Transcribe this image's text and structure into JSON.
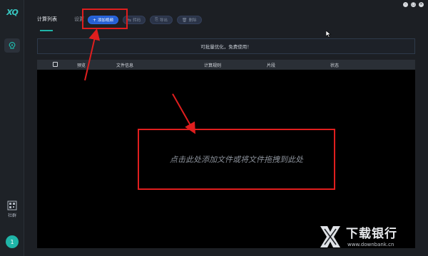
{
  "app": {
    "logo_text": "XQ"
  },
  "window": {
    "controls": [
      "minimize",
      "maximize",
      "close"
    ]
  },
  "tabs": [
    {
      "label": "计算列表",
      "active": true
    },
    {
      "label": "设置",
      "active": false
    }
  ],
  "toolbar": {
    "add_label": "添加视频",
    "transcode_label": "转码",
    "export_label": "导出",
    "delete_label": "删除"
  },
  "notice": {
    "text": "可批量优化，免费使用！"
  },
  "table": {
    "columns": [
      "预览",
      "文件信息",
      "计算规则",
      "片段",
      "状态"
    ],
    "rows": []
  },
  "dropzone": {
    "text": "点击此处添加文件或将文件拖拽到此处"
  },
  "sidebar": {
    "community_label": "社群",
    "user_badge": "1"
  },
  "watermark": {
    "title": "下载银行",
    "url": "www.downbank.cn"
  },
  "colors": {
    "accent": "#1fb5a8",
    "primary_button": "#2560d4",
    "annotation_red": "#e01e1e",
    "background": "#1c1f24",
    "table_bg": "#000000"
  },
  "icons": {
    "brain": "brain-icon",
    "community": "qr-community-icon",
    "add": "plus-icon",
    "transcode": "convert-icon",
    "export": "export-icon",
    "delete": "trash-icon"
  }
}
